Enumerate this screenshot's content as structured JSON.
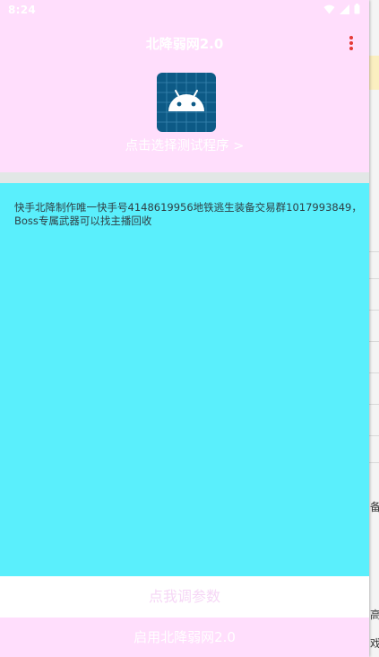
{
  "status_bar": {
    "time": "8:24"
  },
  "header": {
    "title": "北降弱网2.0",
    "select_program_link": "点击选择测试程序 >"
  },
  "main": {
    "info_text": "快手北降制作唯一快手号4148619956地铁逃生装备交易群1017993849，Boss专属武器可以找主播回收"
  },
  "buttons": {
    "adjust_params": "点我调参数",
    "start": "启用北降弱网2.0"
  },
  "background_app": {
    "glyphs": [
      "备",
      "高",
      "戏"
    ]
  },
  "icons": {
    "wifi": "wifi-icon",
    "signal": "signal-icon",
    "battery": "battery-icon",
    "overflow": "more-vert-icon",
    "app": "android-icon"
  },
  "colors": {
    "header_bg": "#ffdefc",
    "content_bg": "#5aeffc",
    "icon_bg": "#0d5a86",
    "menu_dots": "#e53935"
  }
}
